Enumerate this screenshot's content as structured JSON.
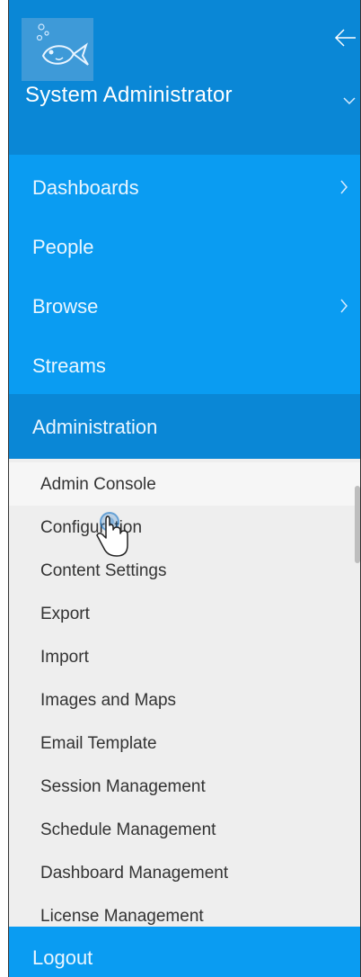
{
  "header": {
    "user_name": "System Administrator",
    "avatar_icon": "fish-icon",
    "back_icon": "arrow-left-icon",
    "chevron_icon": "chevron-down-icon"
  },
  "nav": {
    "items": [
      {
        "label": "Dashboards",
        "has_submenu": true
      },
      {
        "label": "People",
        "has_submenu": false
      },
      {
        "label": "Browse",
        "has_submenu": true
      },
      {
        "label": "Streams",
        "has_submenu": false
      }
    ]
  },
  "admin": {
    "label": "Administration",
    "items": [
      {
        "label": "Admin Console"
      },
      {
        "label": "Configuration"
      },
      {
        "label": "Content Settings"
      },
      {
        "label": "Export"
      },
      {
        "label": "Import"
      },
      {
        "label": "Images and Maps"
      },
      {
        "label": "Email Template"
      },
      {
        "label": "Session Management"
      },
      {
        "label": "Schedule Management"
      },
      {
        "label": "Dashboard Management"
      },
      {
        "label": "License Management"
      }
    ]
  },
  "footer": {
    "logout_label": "Logout"
  },
  "colors": {
    "header_bg": "#0a87d6",
    "nav_bg": "#0a9cf2",
    "submenu_bg": "#eeeeee"
  }
}
